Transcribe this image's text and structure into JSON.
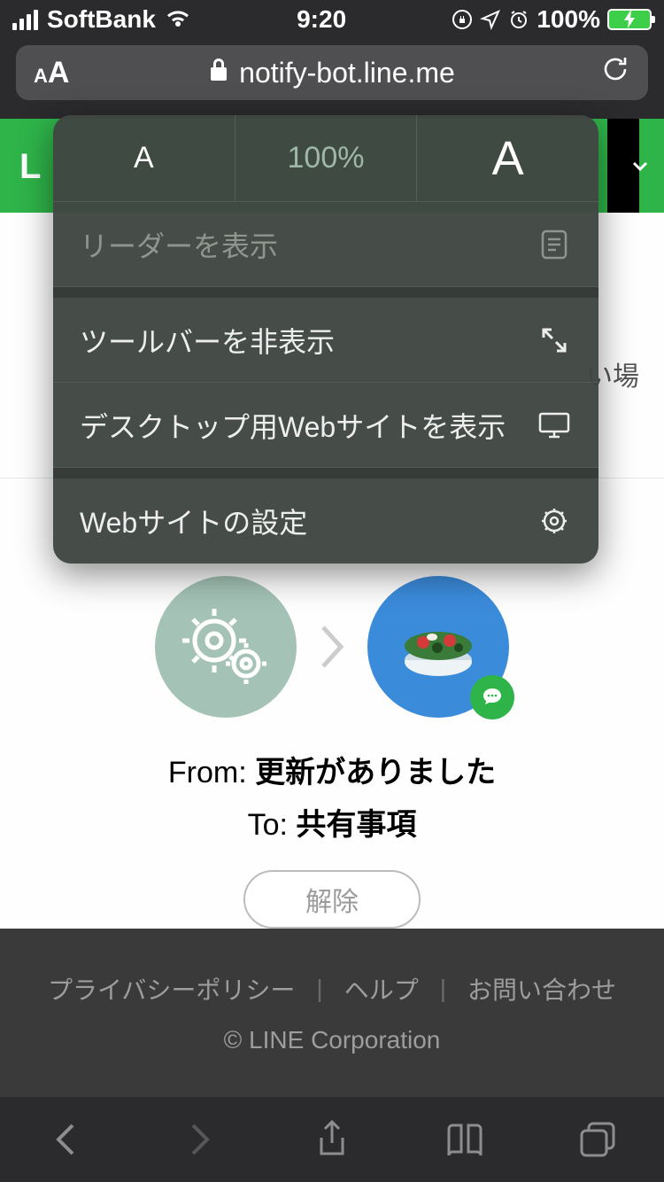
{
  "status": {
    "carrier": "SoftBank",
    "time": "9:20",
    "battery_percent": "100%"
  },
  "url_bar": {
    "domain": "notify-bot.line.me"
  },
  "aa_popup": {
    "zoom_percent": "100%",
    "small_a": "A",
    "big_a": "A",
    "reader": "リーダーを表示",
    "hide_toolbar": "ツールバーを非表示",
    "request_desktop": "デスクトップ用Webサイトを表示",
    "website_settings": "Webサイトの設定"
  },
  "page": {
    "trailing_fragment": "い場",
    "from_label": "From:",
    "from_value": "更新がありました",
    "to_label": "To:",
    "to_value": "共有事項",
    "remove_button": "解除"
  },
  "footer": {
    "privacy": "プライバシーポリシー",
    "help": "ヘルプ",
    "contact": "お問い合わせ",
    "copyright": "© LINE Corporation"
  },
  "line_header": {
    "logo_initial": "L"
  }
}
